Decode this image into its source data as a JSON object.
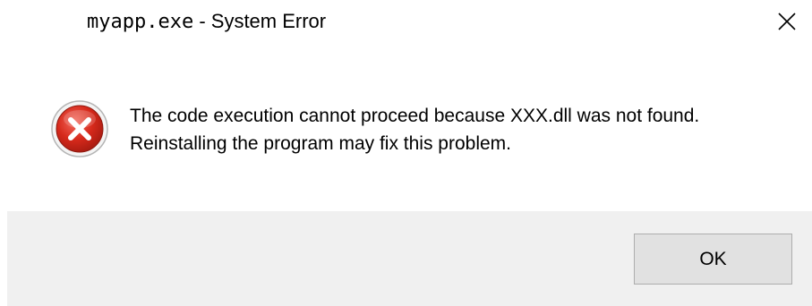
{
  "window": {
    "title_exe": "myapp.exe",
    "title_rest": " - System Error"
  },
  "message": {
    "line1": "The code execution cannot proceed because XXX.dll was not found.",
    "line2": "Reinstalling the program may fix this problem."
  },
  "buttons": {
    "ok_label": "OK"
  },
  "icons": {
    "close": "close-icon",
    "error": "error-icon"
  },
  "colors": {
    "error_red": "#c42b1c",
    "footer_bg": "#f0f0f0",
    "button_bg": "#e1e1e1",
    "button_border": "#adadad"
  }
}
